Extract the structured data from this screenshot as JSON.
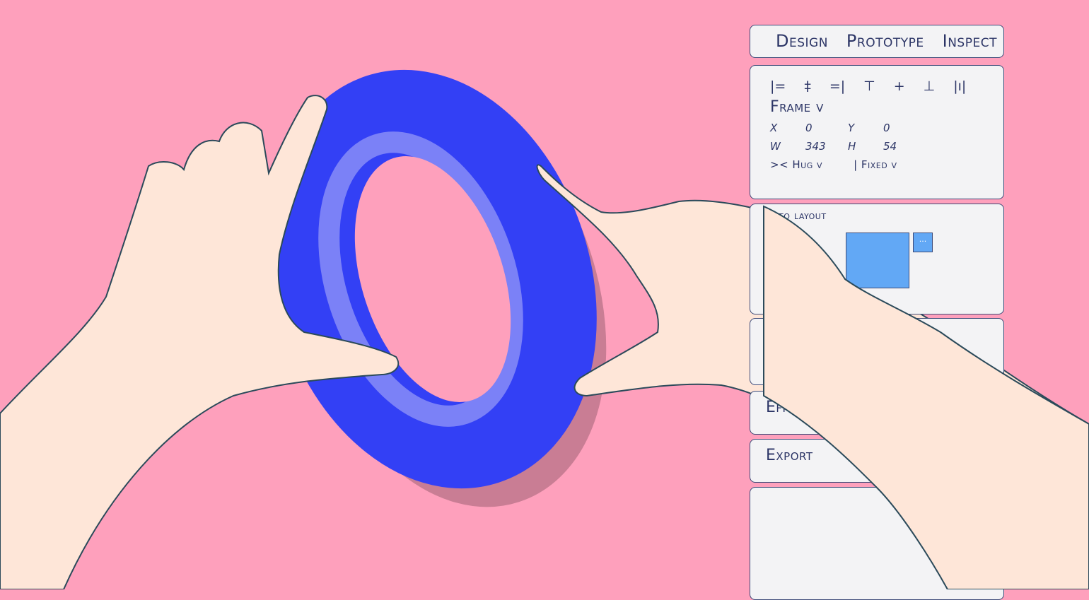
{
  "tabs": [
    "Design",
    "Prototype",
    "Inspect"
  ],
  "align_icons": [
    "align-left-icon",
    "align-center-h-icon",
    "align-right-icon",
    "align-top-icon",
    "align-center-v-icon",
    "align-bottom-icon",
    "distribute-icon"
  ],
  "align_glyphs": [
    "|=",
    "‡",
    "=|",
    "⊤",
    "+",
    "⊥",
    "|ı|"
  ],
  "frame": {
    "label": "Frame v",
    "x_label": "X",
    "x": "0",
    "y_label": "Y",
    "y": "0",
    "w_label": "W",
    "w": "343",
    "h_label": "H",
    "h": "54",
    "hug": ">< Hug v",
    "fixed": "| Fixed v"
  },
  "auto_layout": {
    "label": "Auto layout",
    "arrow": "→",
    "more": "···"
  },
  "effect": "Effect",
  "export": "Export",
  "colors": {
    "background": "#fea0bc",
    "ring": "#3340f5",
    "skin": "#fee6d8",
    "panel": "#f3f3f5",
    "accent": "#62a8f5"
  }
}
